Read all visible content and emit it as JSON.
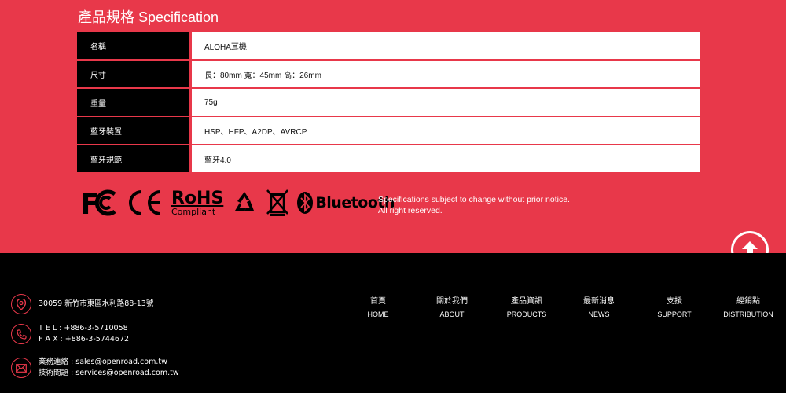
{
  "spec": {
    "title": "產品規格 Specification",
    "rows": [
      {
        "label": "名稱",
        "value": "ALOHA耳機"
      },
      {
        "label": "尺寸",
        "value": "長：80mm 寬：45mm 高：26mm"
      },
      {
        "label": "重量",
        "value": "75g"
      },
      {
        "label": "藍牙裝置",
        "value": "HSP、HFP、A2DP、AVRCP"
      },
      {
        "label": "藍牙規範",
        "value": "藍牙4.0"
      }
    ]
  },
  "certs": {
    "rohs": "RoHS",
    "rohs_sub": "Compliant",
    "bluetooth": "Bluetooth",
    "fc": "FC",
    "ce": "CE"
  },
  "notice": {
    "line1": "Specifications subject to change without prior notice.",
    "line2": "All right reserved."
  },
  "footer": {
    "address": "30059  新竹市東區水利路88-13號",
    "tel": "T E L : +886-3-5710058",
    "fax": "F A X : +886-3-5744672",
    "sales": "業務連絡 : sales@openroad.com.tw",
    "support_email": "技術問題 : services@openroad.com.tw"
  },
  "nav": [
    {
      "zh": "首頁",
      "en": "HOME"
    },
    {
      "zh": "關於我們",
      "en": "ABOUT"
    },
    {
      "zh": "產品資訊",
      "en": "PRODUCTS"
    },
    {
      "zh": "最新消息",
      "en": "NEWS"
    },
    {
      "zh": "支援",
      "en": "SUPPORT"
    },
    {
      "zh": "經銷點",
      "en": "DISTRIBUTION"
    }
  ],
  "colors": {
    "accent": "#e8384a",
    "dark": "#000000"
  }
}
